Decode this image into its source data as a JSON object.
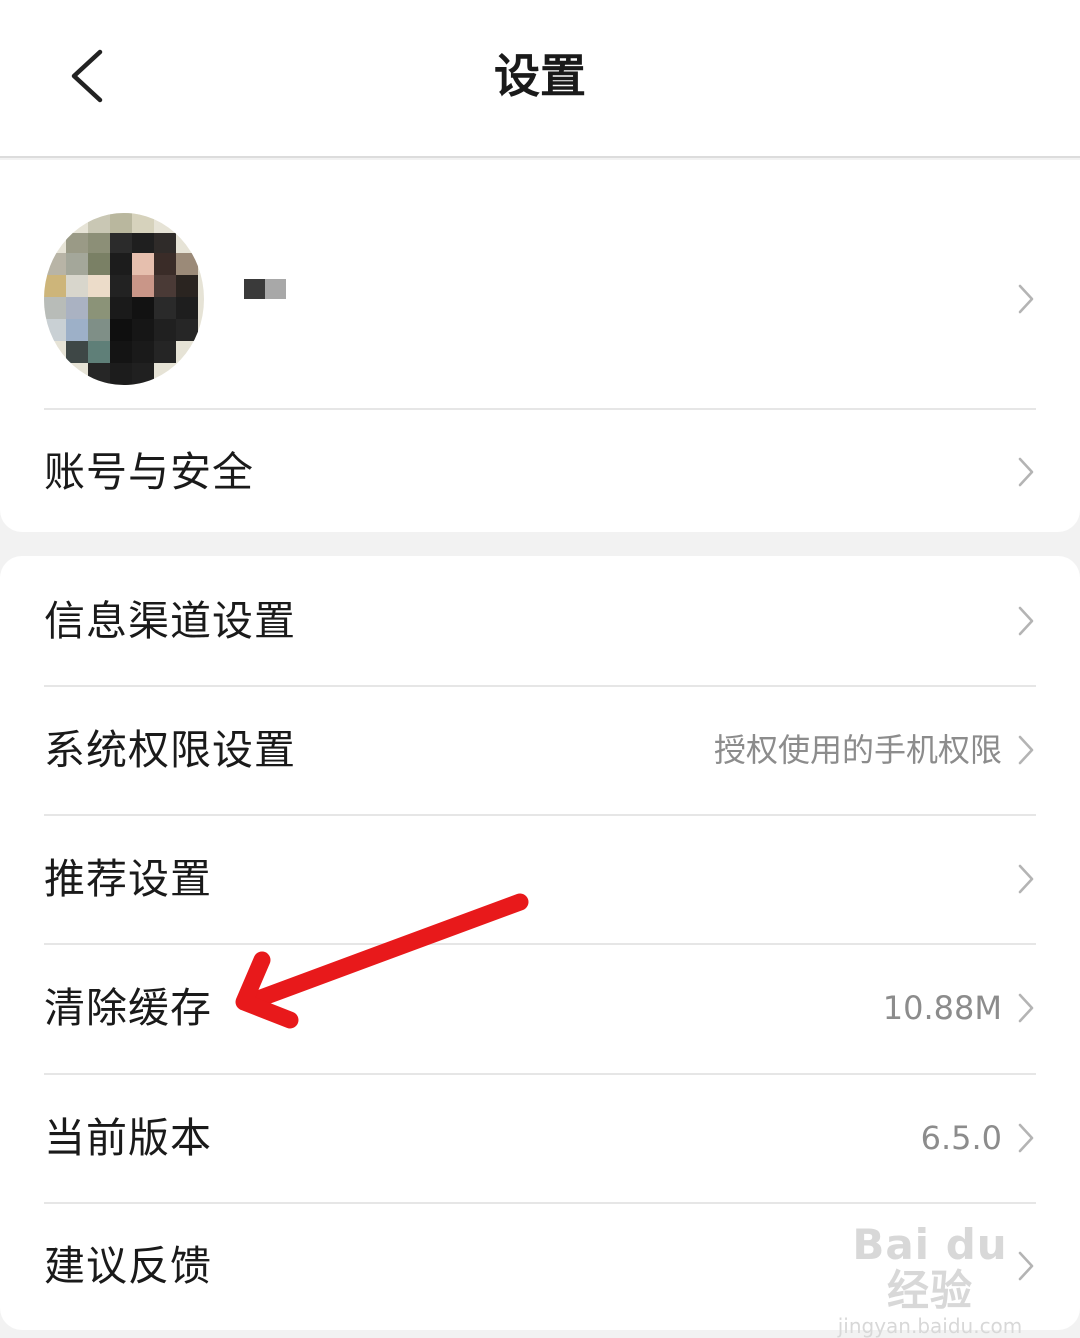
{
  "header": {
    "title": "设置",
    "back_icon": "chevron-left-icon"
  },
  "profile": {
    "avatar": "pixelated-avatar",
    "name": ""
  },
  "section1": {
    "items": [
      {
        "label": "账号与安全",
        "value": ""
      }
    ]
  },
  "section2": {
    "items": [
      {
        "label": "信息渠道设置",
        "value": ""
      },
      {
        "label": "系统权限设置",
        "value": "授权使用的手机权限"
      },
      {
        "label": "推荐设置",
        "value": ""
      },
      {
        "label": "清除缓存",
        "value": "10.88M"
      },
      {
        "label": "当前版本",
        "value": "6.5.0"
      },
      {
        "label": "建议反馈",
        "value": ""
      }
    ]
  },
  "watermark": {
    "main": "Bai du 经验",
    "sub": "jingyan.baidu.com"
  },
  "colors": {
    "annotation_arrow": "#e8191b",
    "value_text": "#8c8c8c",
    "divider": "#e6e6e6"
  }
}
